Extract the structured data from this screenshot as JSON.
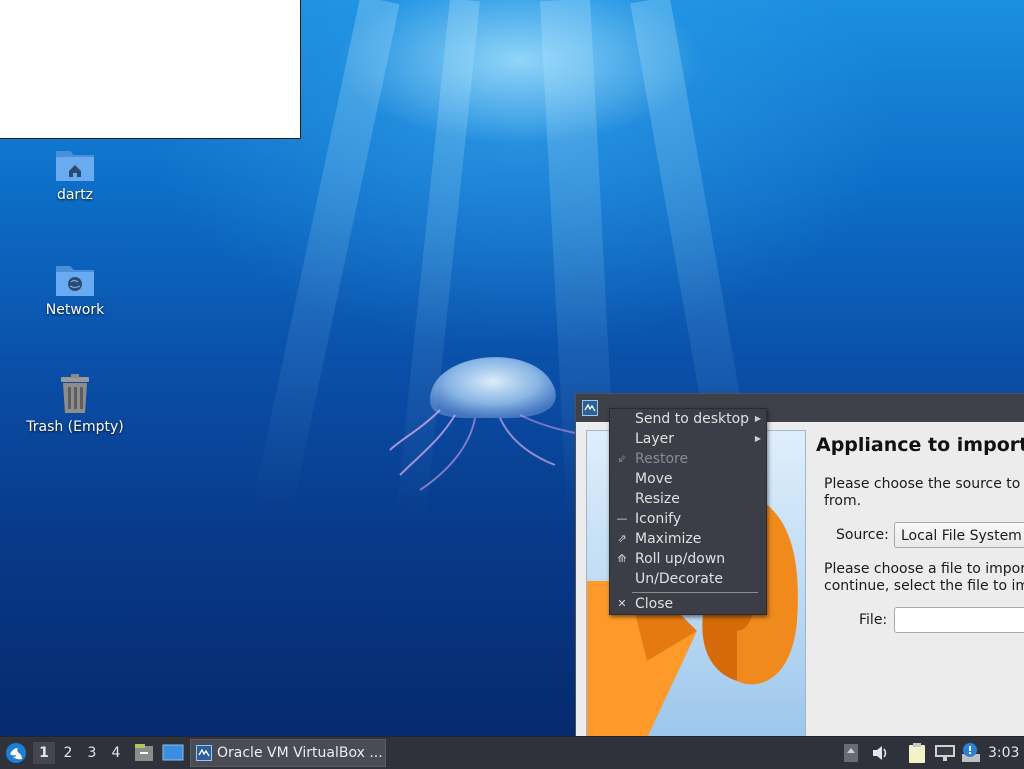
{
  "desktop": {
    "icons": [
      {
        "label": "dartz",
        "icon": "home-folder-icon"
      },
      {
        "label": "Network",
        "icon": "network-folder-icon"
      },
      {
        "label": "Trash (Empty)",
        "icon": "trash-icon"
      }
    ]
  },
  "dialog": {
    "heading": "Appliance to import",
    "source_text_line1": "Please choose the source to i",
    "source_text_line2": "from.",
    "source_label": "Source:",
    "source_value": "Local File System",
    "file_text_line1": "Please choose a file to import",
    "file_text_line2": "continue, select the file to imp",
    "file_label": "File:",
    "file_value": ""
  },
  "context_menu": {
    "items": [
      {
        "label": "Send to desktop",
        "icon": "",
        "submenu": true,
        "disabled": false
      },
      {
        "label": "Layer",
        "icon": "",
        "submenu": true,
        "disabled": false
      },
      {
        "label": "Restore",
        "icon": "restore-icon",
        "submenu": false,
        "disabled": true
      },
      {
        "label": "Move",
        "icon": "",
        "submenu": false,
        "disabled": false
      },
      {
        "label": "Resize",
        "icon": "",
        "submenu": false,
        "disabled": false
      },
      {
        "label": "Iconify",
        "icon": "iconify-icon",
        "submenu": false,
        "disabled": false
      },
      {
        "label": "Maximize",
        "icon": "maximize-icon",
        "submenu": false,
        "disabled": false
      },
      {
        "label": "Roll up/down",
        "icon": "roll-up-icon",
        "submenu": false,
        "disabled": false
      },
      {
        "label": "Un/Decorate",
        "icon": "",
        "submenu": false,
        "disabled": false
      },
      {
        "label": "Close",
        "icon": "close-icon",
        "submenu": false,
        "disabled": false
      }
    ]
  },
  "taskbar": {
    "workspaces": [
      "1",
      "2",
      "3",
      "4"
    ],
    "active_workspace": "1",
    "task_label": "Oracle VM VirtualBox ...",
    "clock": "3:03"
  },
  "colors": {
    "taskbar_bg": "#2f323a",
    "menu_bg": "#3b3e46",
    "accent": "#1c7fd6"
  }
}
